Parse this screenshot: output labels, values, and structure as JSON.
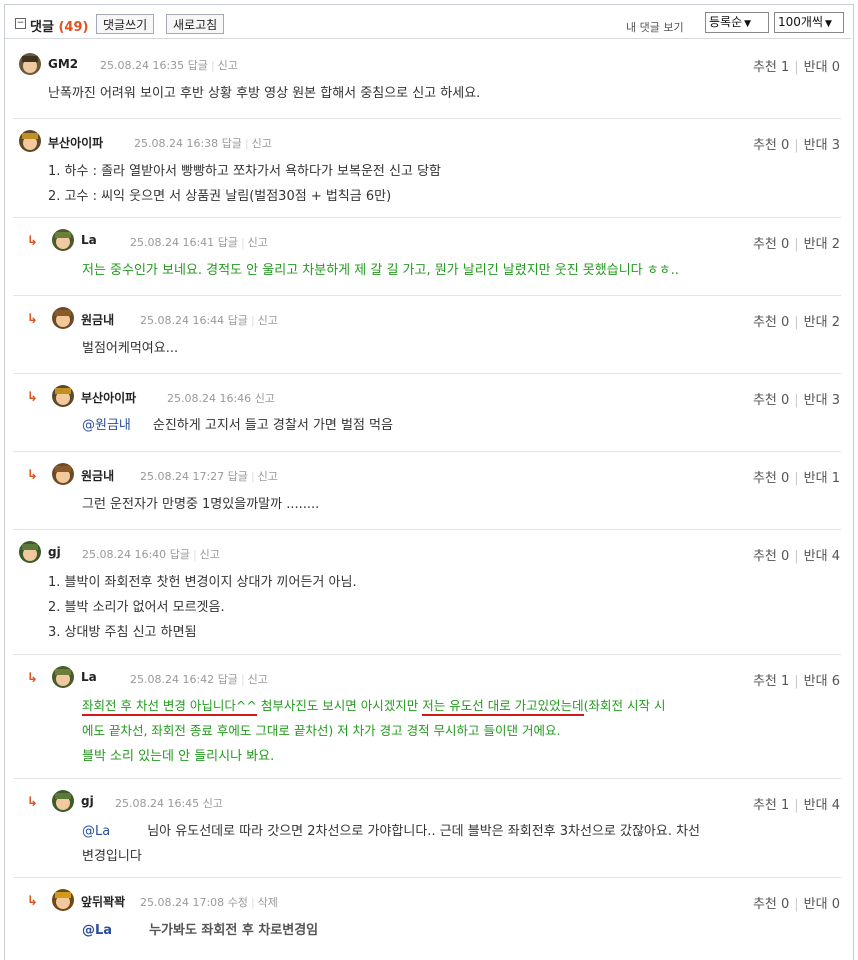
{
  "header": {
    "collapse_icon": "minus-square-icon",
    "title": "댓글",
    "count": "(49)",
    "write_button": "댓글쓰기",
    "refresh_button": "새로고침",
    "my_comments_link": "내 댓글 보기",
    "sort_value": "등록순",
    "per_page_value": "100개씩"
  },
  "comments": [
    {
      "nick": "GM2",
      "date": "25.08.24 16:35",
      "actions": [
        "답글",
        "신고"
      ],
      "up": "추천 1",
      "down": "반대 0",
      "lines": [
        "난폭까진 어려워 보이고 후반 상황 후방 영상 원본 합해서 중침으로 신고 하세요."
      ]
    },
    {
      "nick": "부산아이파",
      "date": "25.08.24 16:38",
      "actions": [
        "답글",
        "신고"
      ],
      "up": "추천 0",
      "down": "반대 3",
      "lines": [
        "1. 하수 : 졸라 열받아서 빵빵하고 쪼차가서 욕하다가 보복운전 신고 당함",
        "2. 고수 : 씨익 웃으면 서 상품권 날림(벌점30점 + 법칙금 6만)"
      ]
    },
    {
      "nick": "La",
      "date": "25.08.24 16:41",
      "actions": [
        "답글",
        "신고"
      ],
      "up": "추천 0",
      "down": "반대 2",
      "lines": [
        "저는 중수인가 보네요. 경적도 안 울리고 차분하게 제 갈 길 가고, 뭔가 날리긴 날렸지만 웃진 못했습니다 ㅎㅎ.."
      ]
    },
    {
      "nick": "원금내",
      "date": "25.08.24 16:44",
      "actions": [
        "답글",
        "신고"
      ],
      "up": "추천 0",
      "down": "반대 2",
      "lines": [
        "벌점어케먹여요..."
      ]
    },
    {
      "nick": "부산아이파",
      "date": "25.08.24 16:46",
      "actions": [
        "신고"
      ],
      "up": "추천 0",
      "down": "반대 3",
      "mention": "@원금내",
      "lines": [
        "순진하게 고지서 들고 경찰서 가면 벌점 먹음"
      ]
    },
    {
      "nick": "원금내",
      "date": "25.08.24 17:27",
      "actions": [
        "답글",
        "신고"
      ],
      "up": "추천 0",
      "down": "반대 1",
      "lines": [
        "그런 운전자가 만명중 1명있을까말까 ........"
      ]
    },
    {
      "nick": "gj",
      "date": "25.08.24 16:40",
      "actions": [
        "답글",
        "신고"
      ],
      "up": "추천 0",
      "down": "반대 4",
      "lines": [
        "1. 블박이 좌회전후 찻헌 변경이지 상대가 끼어든거 아님.",
        "2. 블박 소리가 없어서 모르겟음.",
        "3. 상대방 주침 신고 하면됨"
      ]
    },
    {
      "nick": "La",
      "date": "25.08.24 16:42",
      "actions": [
        "답글",
        "신고"
      ],
      "up": "추천 1",
      "down": "반대 6",
      "l1a": "좌회전 후 차선 변경 아닙니다^^",
      "l1b": " 첨부사진도 보시면 아시겠지만 ",
      "l1c": "저는 유도선 대로 가고있었는데",
      "l1d": "(좌회전 시작 시",
      "lines": [
        "에도 끝차선, 좌회전 종료 후에도 그대로 끝차선) 저 차가 경고 경적 무시하고 들이댄 거에요.",
        "블박 소리 있는데 안 들리시나 봐요."
      ]
    },
    {
      "nick": "gj",
      "date": "25.08.24 16:45",
      "actions": [
        "신고"
      ],
      "up": "추천 1",
      "down": "반대 4",
      "mention": "@La",
      "lines": [
        "님아 유도선데로 따라 갓으면 2차선으로 가야합니다.. 근데 블박은 좌회전후 3차선으로 갔잖아요. 차선",
        "변경입니다"
      ]
    },
    {
      "nick": "앞뒤꽉꽉",
      "date": "25.08.24 17:08",
      "actions": [
        "수정",
        "삭제"
      ],
      "up": "추천 0",
      "down": "반대 0",
      "mention": "@La",
      "lines": [
        "누가봐도 좌회전 후 차로변경임"
      ]
    }
  ]
}
